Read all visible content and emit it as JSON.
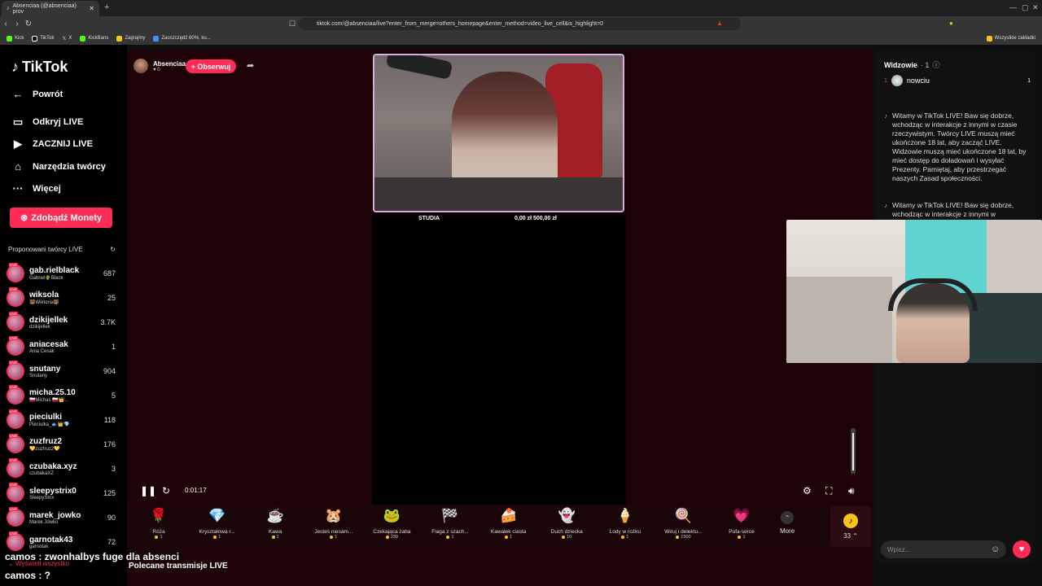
{
  "browser": {
    "tab_title": "Absenciaa (@absenciaa) prov",
    "url": "tiktok.com/@absenciaa/live?enter_from_merge=others_homepage&enter_method=video_live_cell&is_highlight=0",
    "bookmarks": [
      "Kick",
      "TikTok",
      "X",
      "KickBans",
      "Zagrajmy",
      "Zaoszczędź 60%, ku..."
    ],
    "all_bookmarks": "Wszystkie zakładki"
  },
  "sidebar": {
    "logo": "TikTok",
    "nav": [
      {
        "icon": "←",
        "label": "Powrót"
      },
      {
        "icon": "▭",
        "label": "Odkryj LIVE"
      },
      {
        "icon": "▶",
        "label": "ZACZNIJ LIVE"
      },
      {
        "icon": "⌂",
        "label": "Narzędzia twórcy"
      },
      {
        "icon": "···",
        "label": "Więcej"
      }
    ],
    "coins_button": "Zdobądź Monety",
    "proposed_title": "Proponowani twórcy LIVE",
    "creators": [
      {
        "name": "gab.rielblack",
        "sub": "Gabriel🌵Black",
        "count": "687"
      },
      {
        "name": "wiksola",
        "sub": "🐻Wiktoria🐻",
        "count": "25"
      },
      {
        "name": "dzikijellek",
        "sub": "dzikijellek",
        "count": "3.7K"
      },
      {
        "name": "aniacesak",
        "sub": "Ania Cesak",
        "count": "1"
      },
      {
        "name": "snutany",
        "sub": "Snutany",
        "count": "904"
      },
      {
        "name": "micha.25.10",
        "sub": "🇵🇱Michaś 🇵🇱👑...",
        "count": "5"
      },
      {
        "name": "pieciulki",
        "sub": "Pieciulka_🐟👑💎",
        "count": "118"
      },
      {
        "name": "zuzfruz2",
        "sub": "💛zuzfruz2💛",
        "count": "176"
      },
      {
        "name": "czubaka.xyz",
        "sub": "czubakaXZ",
        "count": "3"
      },
      {
        "name": "sleepystrix0",
        "sub": "SleepyStrix",
        "count": "125"
      },
      {
        "name": "marek_jowko",
        "sub": "Marek Jówko",
        "count": "90"
      },
      {
        "name": "garnotak43",
        "sub": "garnotak",
        "count": "72"
      }
    ],
    "show_all": "Wyświetl wszystko"
  },
  "host": {
    "name": "Absenciaa",
    "likes": "0",
    "follow_label": "+ Obserwuj"
  },
  "stream": {
    "bar_left": "STUDIA",
    "bar_right": "0,00 zł  500,00 zł",
    "timer": "0:01:17"
  },
  "gifts": [
    {
      "icon": "🌹",
      "name": "Róża",
      "price": "1"
    },
    {
      "icon": "💎",
      "name": "Kryształowa r...",
      "price": "1"
    },
    {
      "icon": "☕",
      "name": "Kawa",
      "price": "1"
    },
    {
      "icon": "🐹",
      "name": "Jesteś niesam...",
      "price": "1"
    },
    {
      "icon": "🐸",
      "name": "Czekająca żaba",
      "price": "299"
    },
    {
      "icon": "🏁",
      "name": "Flaga z szach...",
      "price": "1"
    },
    {
      "icon": "🍰",
      "name": "Kawałek ciasta",
      "price": "1"
    },
    {
      "icon": "👻",
      "name": "Duch dziecka",
      "price": "10"
    },
    {
      "icon": "🍦",
      "name": "Lody w rożku",
      "price": "1"
    },
    {
      "icon": "🍭",
      "name": "Wiruj i delektu...",
      "price": "1500"
    },
    {
      "icon": "💗",
      "name": "Pufa-serce",
      "price": "1"
    }
  ],
  "more_label": "More",
  "coin_count": "33",
  "viewers": {
    "title": "Widzowie",
    "count": "· 1",
    "top": {
      "rank": "1",
      "name": "nowciu",
      "score": "1"
    }
  },
  "chat": {
    "messages": [
      "Witamy w TikTok LIVE! Baw się dobrze, wchodząc w interakcje z innymi w czasie rzeczywistym. Twórcy LIVE muszą mieć ukończone 18 lat, aby zacząć LIVE. Widzowie muszą mieć ukończone 18 lat, by mieć dostęp do doładowań i wysyłać Prezenty. Pamiętaj, aby przestrzegać naszych Zasad społeczności.",
      "Witamy w TikTok LIVE! Baw się dobrze, wchodząc w interakcje z innymi w"
    ],
    "input_placeholder": "Wpisz..."
  },
  "overlay": {
    "line1": "camos : zwonhalbys fuge dla absenci",
    "line2": "camos : ?",
    "recommended": "Polecane transmisje LIVE"
  },
  "colors": {
    "brand": "#fe2c55",
    "stage_bg": "#1d0306",
    "coin": "#f5c518"
  }
}
